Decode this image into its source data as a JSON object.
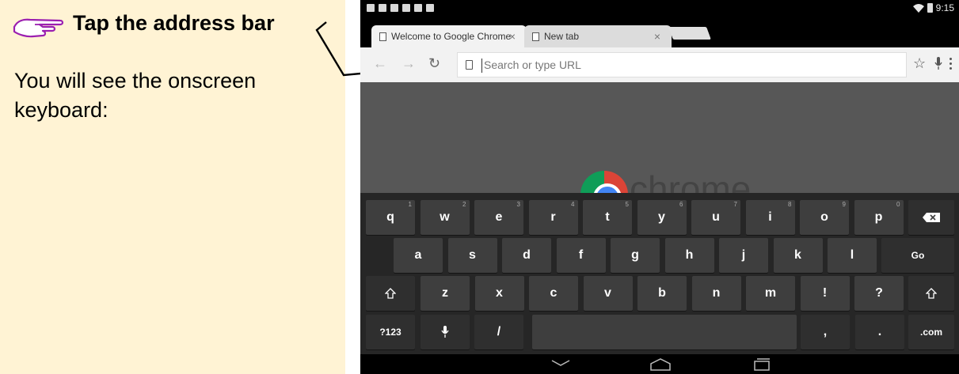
{
  "instruction": {
    "title": "Tap the address bar",
    "body": "You will see the onscreen keyboard:"
  },
  "status_bar": {
    "time": "9:15"
  },
  "tabs": [
    {
      "label": "Welcome to Google Chrome",
      "close": "×"
    },
    {
      "label": "New tab",
      "close": "×"
    }
  ],
  "omnibox": {
    "placeholder": "Search or type URL",
    "value": ""
  },
  "page": {
    "logo_text": "chrome"
  },
  "keyboard": {
    "row1": [
      {
        "label": "q",
        "hint": "1"
      },
      {
        "label": "w",
        "hint": "2"
      },
      {
        "label": "e",
        "hint": "3"
      },
      {
        "label": "r",
        "hint": "4"
      },
      {
        "label": "t",
        "hint": "5"
      },
      {
        "label": "y",
        "hint": "6"
      },
      {
        "label": "u",
        "hint": "7"
      },
      {
        "label": "i",
        "hint": "8"
      },
      {
        "label": "o",
        "hint": "9"
      },
      {
        "label": "p",
        "hint": "0"
      }
    ],
    "row2": [
      "a",
      "s",
      "d",
      "f",
      "g",
      "h",
      "j",
      "k",
      "l"
    ],
    "row3": [
      "z",
      "x",
      "c",
      "v",
      "b",
      "n",
      "m",
      "!",
      "?"
    ],
    "go_label": "Go",
    "symbols_label": "?123",
    "slash_label": "/",
    "comma_label": ",",
    "period_label": ".",
    "com_label": ".com"
  },
  "colors": {
    "instruction_bg": "#fff3d4",
    "keyboard_bg": "#262626",
    "key_bg": "#3e3e3e",
    "content_bg": "#575757"
  }
}
